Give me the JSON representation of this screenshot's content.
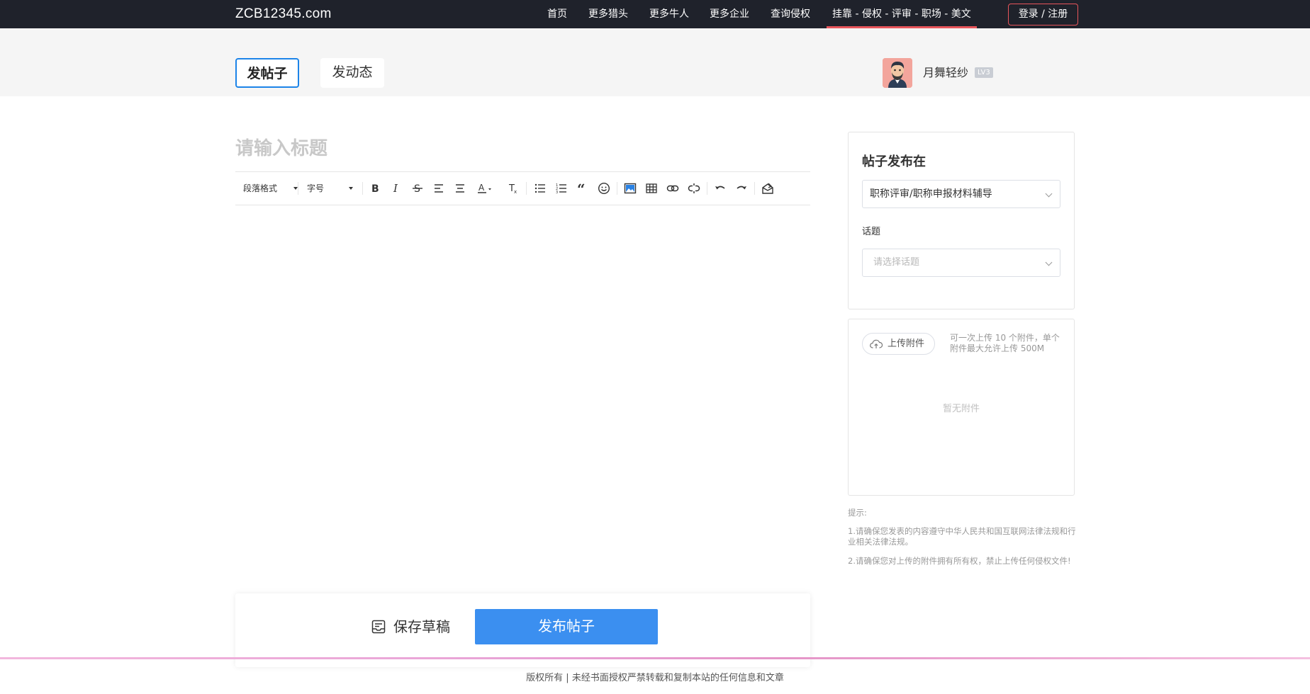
{
  "header": {
    "logo": "ZCB12345.com",
    "nav": [
      {
        "label": "首页"
      },
      {
        "label": "更多猎头"
      },
      {
        "label": "更多牛人"
      },
      {
        "label": "更多企业"
      },
      {
        "label": "查询侵权"
      },
      {
        "label": "挂靠 - 侵权 - 评审 - 职场 - 美文",
        "active": true
      }
    ],
    "login_label": "登录 / 注册"
  },
  "tabs": {
    "post": "发帖子",
    "status": "发动态"
  },
  "user": {
    "name": "月舞轻纱",
    "level": "LV3"
  },
  "editor": {
    "title_placeholder": "请输入标题",
    "paragraph_format": "段落格式",
    "font_size": "字号",
    "tools": [
      "bold-icon",
      "italic-icon",
      "strikethrough-icon",
      "align-left-icon",
      "align-center-icon",
      "font-color-icon",
      "clear-format-icon",
      "bullet-list-icon",
      "numbered-list-icon",
      "quote-icon",
      "emoji-icon",
      "image-icon",
      "table-icon",
      "link-icon",
      "unlink-icon",
      "undo-icon",
      "redo-icon",
      "draft-icon"
    ]
  },
  "publish_panel": {
    "title": "帖子发布在",
    "category_value": "职称评审/职称申报材料辅导",
    "topic_label": "话题",
    "topic_placeholder": "请选择话题"
  },
  "attachments": {
    "upload_label": "上传附件",
    "tip": "可一次上传 10 个附件，单个附件最大允许上传 500M",
    "empty": "暂无附件"
  },
  "hints": {
    "title": "提示:",
    "item1": "1.请确保您发表的内容遵守中华人民共和国互联网法律法规和行业相关法律法规。",
    "item2": "2.请确保您对上传的附件拥有所有权，禁止上传任何侵权文件!"
  },
  "actions": {
    "save_draft": "保存草稿",
    "publish": "发布帖子"
  },
  "footer": {
    "text": "版权所有 | 未经书面授权严禁转载和复制本站的任何信息和文章"
  },
  "colors": {
    "nav_bg": "#1f222b",
    "accent_red": "#e8555b",
    "primary_blue": "#3b8ff0",
    "tab_border": "#1c84e8"
  }
}
